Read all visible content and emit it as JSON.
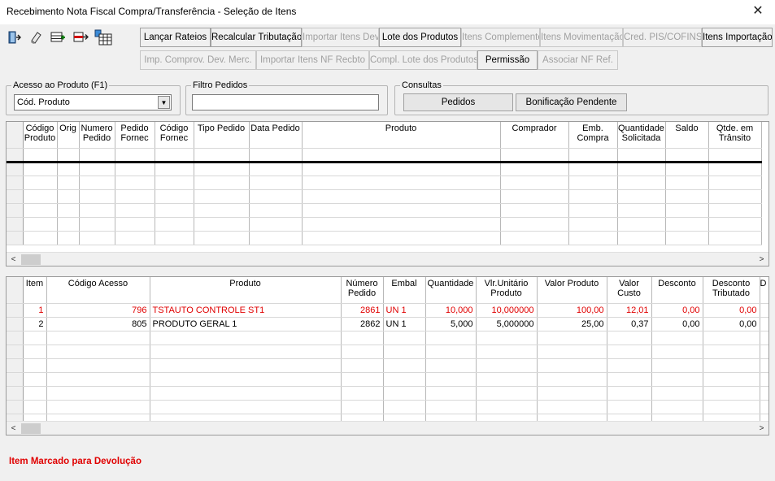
{
  "window": {
    "title": "Recebimento Nota Fiscal Compra/Transferência - Seleção de Itens",
    "close_symbol": "✕"
  },
  "toolbar_icons": [
    "exit-door-icon",
    "eraser-icon",
    "add-row-icon",
    "remove-row-icon",
    "grid-select-icon"
  ],
  "action_buttons_row1": [
    {
      "label": "Lançar Rateios",
      "enabled": true
    },
    {
      "label": "Recalcular Tributação",
      "enabled": true
    },
    {
      "label": "Importar Itens Dev.",
      "enabled": false
    },
    {
      "label": "Lote dos Produtos",
      "enabled": true
    },
    {
      "label": "Itens Complemento",
      "enabled": false
    },
    {
      "label": "Itens Movimentação",
      "enabled": false
    },
    {
      "label": "Cred. PIS/COFINS",
      "enabled": false
    },
    {
      "label": "Itens Importação",
      "enabled": true
    }
  ],
  "action_buttons_row2": [
    {
      "label": "Imp. Comprov. Dev. Merc.",
      "enabled": false
    },
    {
      "label": "Importar Itens NF Recbto",
      "enabled": false
    },
    {
      "label": "Compl. Lote dos Produtos",
      "enabled": false
    },
    {
      "label": "Permissão",
      "enabled": true
    },
    {
      "label": "Associar NF Ref.",
      "enabled": false
    }
  ],
  "acesso_produto": {
    "legend": "Acesso ao Produto (F1)",
    "selected": "Cód. Produto"
  },
  "filtro_pedidos": {
    "legend": "Filtro Pedidos",
    "value": ""
  },
  "consultas": {
    "legend": "Consultas",
    "pedidos_label": "Pedidos",
    "bonificacao_label": "Bonificação Pendente"
  },
  "orders_grid": {
    "columns": [
      "Código Produto",
      "Orig",
      "Numero Pedido",
      "Pedido Fornec",
      "Código Fornec",
      "Tipo Pedido",
      "Data Pedido",
      "Produto",
      "Comprador",
      "Emb. Compra",
      "Quantidade Solicitada",
      "Saldo",
      "Qtde. em Trânsito"
    ]
  },
  "items_grid": {
    "columns": [
      "Item",
      "Código Acesso",
      "Produto",
      "Número Pedido",
      "Embal",
      "Quantidade",
      "Vlr.Unitário Produto",
      "Valor Produto",
      "Valor Custo",
      "Desconto",
      "Desconto Tributado",
      "D S"
    ],
    "rows": [
      {
        "item": "1",
        "codigo": "796",
        "produto": "TSTAUTO CONTROLE ST1",
        "pedido": "2861",
        "embal": "UN  1",
        "qtd": "10,000",
        "vlr_unit": "10,000000",
        "valor": "100,00",
        "custo": "12,01",
        "desconto": "0,00",
        "desc_trib": "0,00",
        "marked": true
      },
      {
        "item": "2",
        "codigo": "805",
        "produto": "PRODUTO GERAL 1",
        "pedido": "2862",
        "embal": "UN  1",
        "qtd": "5,000",
        "vlr_unit": "5,000000",
        "valor": "25,00",
        "custo": "0,37",
        "desconto": "0,00",
        "desc_trib": "0,00",
        "marked": false
      }
    ]
  },
  "status_message": "Item Marcado para Devolução",
  "colors": {
    "marked_row": "#e00000"
  }
}
